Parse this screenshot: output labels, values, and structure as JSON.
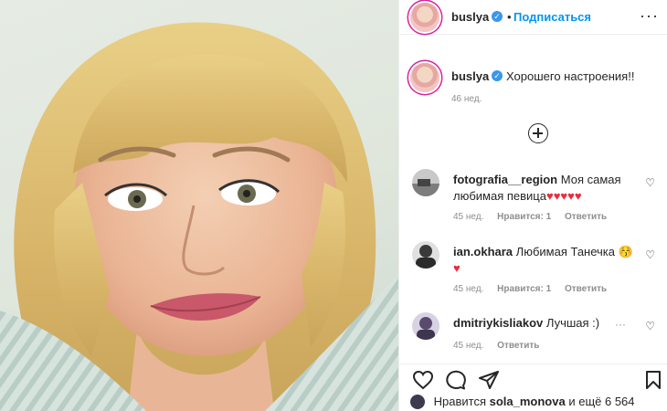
{
  "post": {
    "author": "buslya",
    "follow_label": "Подписаться",
    "dot": "•",
    "caption": "Хорошего настроения!!",
    "caption_time": "46 нед."
  },
  "comments": [
    {
      "user": "fotografia__region",
      "text": "Моя самая любимая певица",
      "hearts": "♥♥♥♥♥",
      "time": "45 нед.",
      "likes": "Нравится: 1",
      "reply": "Ответить"
    },
    {
      "user": "ian.okhara",
      "text": "Любимая Танечка 😚",
      "hearts": "♥",
      "time": "45 нед.",
      "likes": "Нравится: 1",
      "reply": "Ответить"
    },
    {
      "user": "dmitriykisliakov",
      "text": "Лучшая :)",
      "opts": "···",
      "time": "45 нед.",
      "reply": "Ответить"
    }
  ],
  "likes_line": {
    "prefix": "Нравится",
    "user": "sola_monova",
    "suffix": "и ещё 6 564"
  },
  "icons": {
    "verified": "verified-badge-icon",
    "more": "more-options-icon",
    "heart": "heart-icon",
    "comment": "comment-icon",
    "share": "share-icon",
    "save": "bookmark-icon",
    "load_more": "plus-circle-icon"
  },
  "colors": {
    "link_blue": "#0095f6",
    "verified_blue": "#3897f0",
    "heart_red": "#ed2a3c",
    "muted": "#8e8e8e"
  }
}
